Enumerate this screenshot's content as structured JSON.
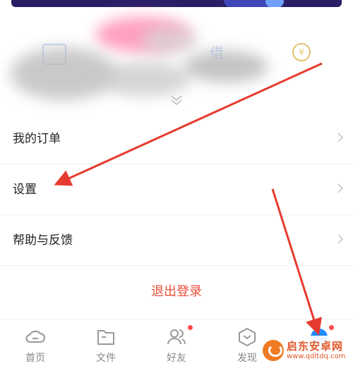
{
  "menu": {
    "items": [
      {
        "label": "我的订单"
      },
      {
        "label": "设置"
      },
      {
        "label": "帮助与反馈"
      }
    ],
    "logout_label": "退出登录"
  },
  "quick_actions": {
    "visible_text": [
      "借"
    ]
  },
  "tabbar": {
    "tabs": [
      {
        "label": "首页",
        "icon": "home-icon"
      },
      {
        "label": "文件",
        "icon": "folder-icon"
      },
      {
        "label": "好友",
        "icon": "friends-icon",
        "badge": true
      },
      {
        "label": "发现",
        "icon": "discover-icon"
      },
      {
        "label": "",
        "icon": "me-icon",
        "badge": true
      }
    ]
  },
  "watermark": {
    "title": "启东安卓网",
    "url": "www.qdltdq.com"
  },
  "colors": {
    "logout": "#ea4d3a",
    "annotation_arrow": "#e53b2f",
    "badge": "#ff4b4b"
  }
}
